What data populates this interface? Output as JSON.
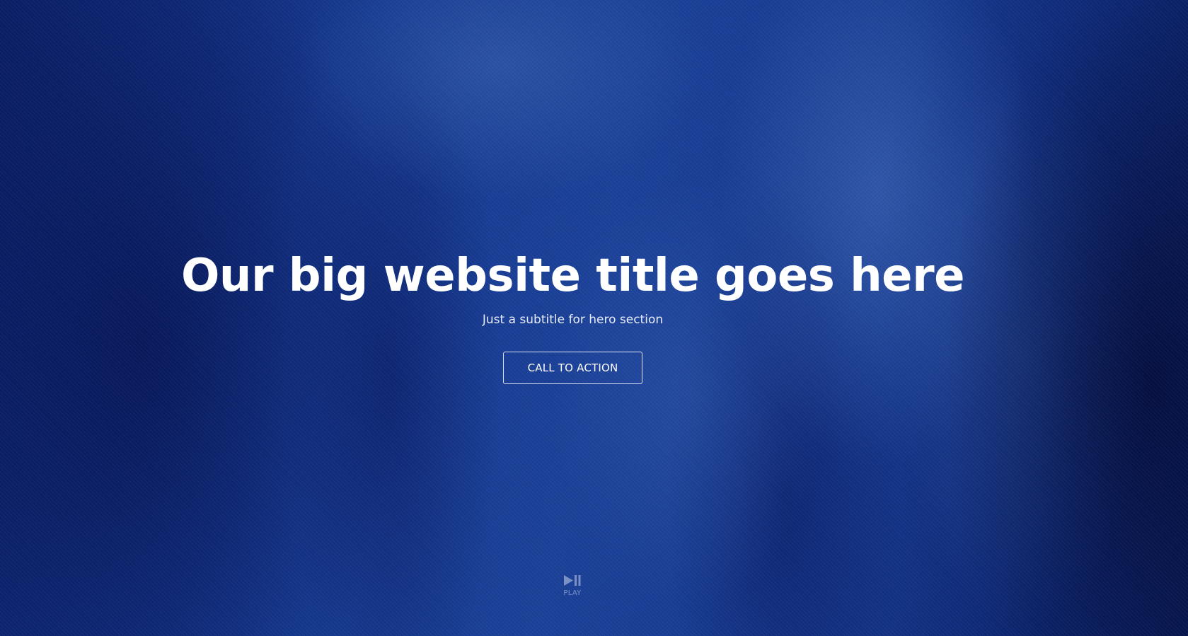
{
  "hero": {
    "title": "Our big website title goes here",
    "subtitle": "Just a subtitle for hero section",
    "cta_label": "CALL TO ACTION"
  },
  "video_control": {
    "icon": "play-pause-icon",
    "label": "PLAY"
  },
  "colors": {
    "background_primary": "#163a92",
    "background_dark": "#0b1f68",
    "text": "#ffffff",
    "control_muted": "#c8d2eb"
  }
}
